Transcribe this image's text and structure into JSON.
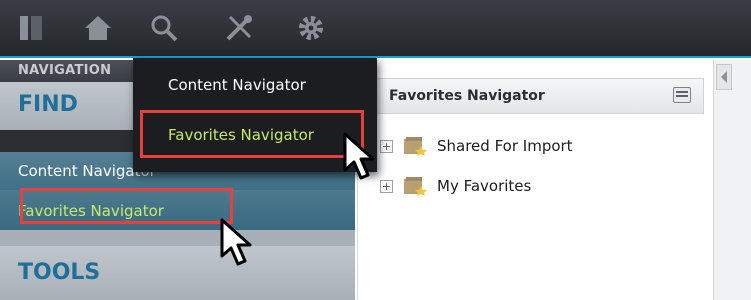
{
  "toolbar": {
    "icons": [
      "sidebar-icon",
      "home-icon",
      "search-icon",
      "tools-icon",
      "gear-icon"
    ]
  },
  "navigation": {
    "header": "NAVIGATION",
    "find_heading": "FIND",
    "items": [
      {
        "label": "Content Navigator"
      },
      {
        "label": "Favorites Navigator"
      }
    ],
    "tools_heading": "TOOLS"
  },
  "dropdown": {
    "items": [
      {
        "label": "Content Navigator"
      },
      {
        "label": "Favorites Navigator"
      }
    ]
  },
  "favorites_panel": {
    "title": "Favorites Navigator",
    "tree": [
      {
        "label": "Shared For Import",
        "expander": "+"
      },
      {
        "label": "My Favorites",
        "expander": "+"
      }
    ]
  },
  "colors": {
    "accent_green": "#c9e86a",
    "highlight_red": "#e8413c",
    "toolbar_blue": "#19a0d8",
    "heading_blue": "#1f6f9a"
  }
}
